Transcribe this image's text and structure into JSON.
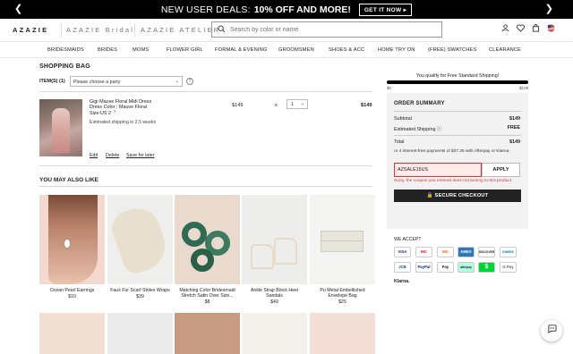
{
  "promo": {
    "prev": "❮",
    "next": "❯",
    "text": "NEW USER DEALS:",
    "bold": "10% OFF AND MORE!",
    "cta": "GET IT NOW ▸"
  },
  "header": {
    "logo_main": "AZAZIE",
    "logo_bridal": "AZAZIE Bridal",
    "logo_atelier": "AZAZIE ATELIER",
    "search_placeholder": "Search by color or name",
    "search_icon": "search-icon",
    "icons": [
      "user-icon",
      "heart-icon",
      "cart-icon",
      "us-flag-icon"
    ]
  },
  "nav": [
    "BRIDESMAIDS",
    "BRIDES",
    "MOMS",
    "FLOWER GIRL",
    "FORMAL & EVENING",
    "GROOMSMEN",
    "SHOES & ACC",
    "HOME TRY ON",
    "(FREE) SWATCHES",
    "CLEARANCE"
  ],
  "bag": {
    "title": "SHOPPING BAG",
    "items_label": "ITEM(S) (1)",
    "party_select": "Please choose a party",
    "item": {
      "name": "Gigi Mauve Floral Midi Dress",
      "color": "Dress Color : Mauve Floral",
      "size": "Size:US 2",
      "shipping": "Estimated shipping in 2.5 weeks",
      "price": "$149",
      "times": "x",
      "qty": "1",
      "total": "$149",
      "edit": "Edit",
      "delete": "Delete",
      "save": "Save for later"
    }
  },
  "you_may_like": {
    "title": "YOU MAY ALSO LIKE",
    "items": [
      {
        "name": "Ocean Pearl Earrings",
        "price": "$10"
      },
      {
        "name": "Faux Fur Scarf Stoles Wraps",
        "price": "$39"
      },
      {
        "name": "Matching Color Bridesmaid Stretch Satin Over Size...",
        "price": "$8"
      },
      {
        "name": "Ankle Strap Block Heel Sandals",
        "price": "$49"
      },
      {
        "name": "Pu Metal Embellished Envelope Bag",
        "price": "$25"
      }
    ]
  },
  "summary": {
    "free_ship": "You qualify for Free Standard Shipping!",
    "bar_min": "$0",
    "bar_max": "$109",
    "progress": 1.0,
    "title": "ORDER SUMMARY",
    "subtotal_label": "Subtotal",
    "subtotal": "$149",
    "shipping_label": "Estimated Shipping ⓘ",
    "shipping": "FREE",
    "total_label": "Total",
    "total": "$149",
    "afterpay": "or 4 interest-free payments of $37.25 with  Afterpay  or  Klarna.",
    "coupon": "AZSALE15US",
    "apply": "APPLY",
    "coupon_error": "Sorry, the coupon you entered does not belong to this product.",
    "checkout": "🔒  SECURE CHECKOUT"
  },
  "payments": {
    "title": "WE ACCEPT",
    "methods": [
      "VISA",
      "MC",
      "MC",
      "AMEX",
      "DISCOVER",
      "DINERS",
      "JCB",
      "PayPal",
      "Pay",
      "afterpay",
      "$",
      "G Pay"
    ],
    "klarna": "Klarna."
  },
  "chat_icon": "chat-icon"
}
